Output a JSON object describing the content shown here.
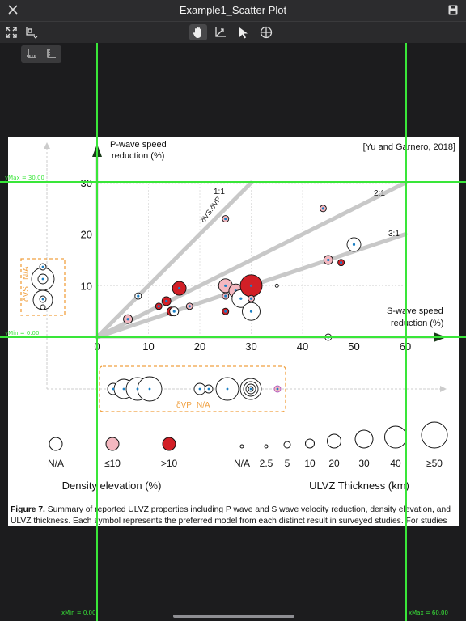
{
  "window": {
    "title": "Example1_Scatter Plot",
    "close_icon": "close-icon",
    "save_icon": "save-icon"
  },
  "toolbar": {
    "left": [
      "fit-screen-icon",
      "axis-settings-icon"
    ],
    "center": [
      "pan-hand-icon",
      "axis-calibrate-icon",
      "pointer-select-icon",
      "crosshair-add-point-icon"
    ],
    "active": "pan-hand-icon"
  },
  "subtoolbar": [
    "x-axis-tool-icon",
    "y-axis-tool-icon"
  ],
  "calibration": {
    "color": "#39e639",
    "ymax_label": "yMax = 30.00",
    "ymin_label": "yMin = 0.00",
    "xmin_label": "xMin = 0.00",
    "xmax_label": "xMax = 60.00"
  },
  "figure": {
    "citation": "[Yu and Garnero, 2018]",
    "ylabel_line1": "P-wave speed",
    "ylabel_line2": "reduction (%)",
    "xlabel_line1": "S-wave speed",
    "xlabel_line2": "reduction (%)",
    "x_ticks": [
      "0",
      "10",
      "20",
      "30",
      "40",
      "50",
      "60"
    ],
    "y_ticks": [
      "10",
      "20",
      "30"
    ],
    "ratio_labels": [
      "1:1",
      "2:1",
      "3:1"
    ],
    "ratio_prefix": "δVS:δVP",
    "dvs_label": "δVS",
    "dvs_na": "N/A",
    "dvp_label": "δVP",
    "dvp_na": "N/A",
    "density_legend": {
      "labels": [
        "N/A",
        "≤10",
        ">10"
      ],
      "title": "Density elevation (%)"
    },
    "thickness_legend": {
      "labels": [
        "N/A",
        "2.5",
        "5",
        "10",
        "20",
        "30",
        "40",
        "≥50"
      ],
      "title": "ULVZ Thickness (km)"
    },
    "colors": {
      "none": "#ffffff",
      "low": "#f4b8c0",
      "high": "#d21f26",
      "guide": "#cccccc",
      "dash": "#f0a040",
      "marker": "#1a7fc4",
      "ring": "#b05cc0"
    }
  },
  "caption": {
    "label": "Figure 7.",
    "text": " Summary of reported ULVZ properties including P wave and S wave velocity reduction, density elevation, and ULVZ thickness. Each symbol represents the preferred model from each distinct result in surveyed studies. For studies"
  },
  "chart_data": {
    "type": "scatter",
    "title": "",
    "xlabel": "S-wave speed reduction (%)",
    "ylabel": "P-wave speed reduction (%)",
    "xlim": [
      0,
      60
    ],
    "ylim": [
      0,
      30
    ],
    "grid": true,
    "reference_lines": [
      {
        "label": "1:1",
        "ratio_vs_to_vp": 1
      },
      {
        "label": "2:1",
        "ratio_vs_to_vp": 2
      },
      {
        "label": "3:1",
        "ratio_vs_to_vp": 3
      }
    ],
    "points": [
      {
        "x": 6,
        "y": 3.5,
        "density": "low",
        "thickness": "10"
      },
      {
        "x": 8,
        "y": 8,
        "density": "na",
        "thickness": "5"
      },
      {
        "x": 12,
        "y": 6,
        "density": "high",
        "thickness": "5"
      },
      {
        "x": 13.5,
        "y": 7,
        "density": "high",
        "thickness": "10"
      },
      {
        "x": 14.5,
        "y": 5,
        "density": "high",
        "thickness": "10"
      },
      {
        "x": 15,
        "y": 5,
        "density": "na",
        "thickness": "10"
      },
      {
        "x": 16,
        "y": 9.5,
        "density": "high",
        "thickness": "20"
      },
      {
        "x": 18,
        "y": 6,
        "density": "low",
        "thickness": "5"
      },
      {
        "x": 25,
        "y": 23,
        "density": "low",
        "thickness": "5"
      },
      {
        "x": 25,
        "y": 10,
        "density": "low",
        "thickness": "20"
      },
      {
        "x": 25,
        "y": 8,
        "density": "low",
        "thickness": "5"
      },
      {
        "x": 25,
        "y": 5,
        "density": "high",
        "thickness": "5"
      },
      {
        "x": 27,
        "y": 9,
        "density": "low",
        "thickness": "20"
      },
      {
        "x": 28,
        "y": 7.5,
        "density": "na",
        "thickness": "30"
      },
      {
        "x": 30,
        "y": 10,
        "density": "high",
        "thickness": "40"
      },
      {
        "x": 30,
        "y": 5,
        "density": "na",
        "thickness": "30"
      },
      {
        "x": 30,
        "y": 7.5,
        "density": "low",
        "thickness": "5"
      },
      {
        "x": 35,
        "y": 10,
        "density": "na",
        "thickness": "2.5"
      },
      {
        "x": 44,
        "y": 25,
        "density": "low",
        "thickness": "5"
      },
      {
        "x": 45,
        "y": 15,
        "density": "low",
        "thickness": "10"
      },
      {
        "x": 45,
        "y": 0,
        "density": "na",
        "thickness": "5"
      },
      {
        "x": 47.5,
        "y": 14.5,
        "density": "high",
        "thickness": "5"
      },
      {
        "x": 50,
        "y": 18,
        "density": "na",
        "thickness": "20"
      }
    ]
  }
}
